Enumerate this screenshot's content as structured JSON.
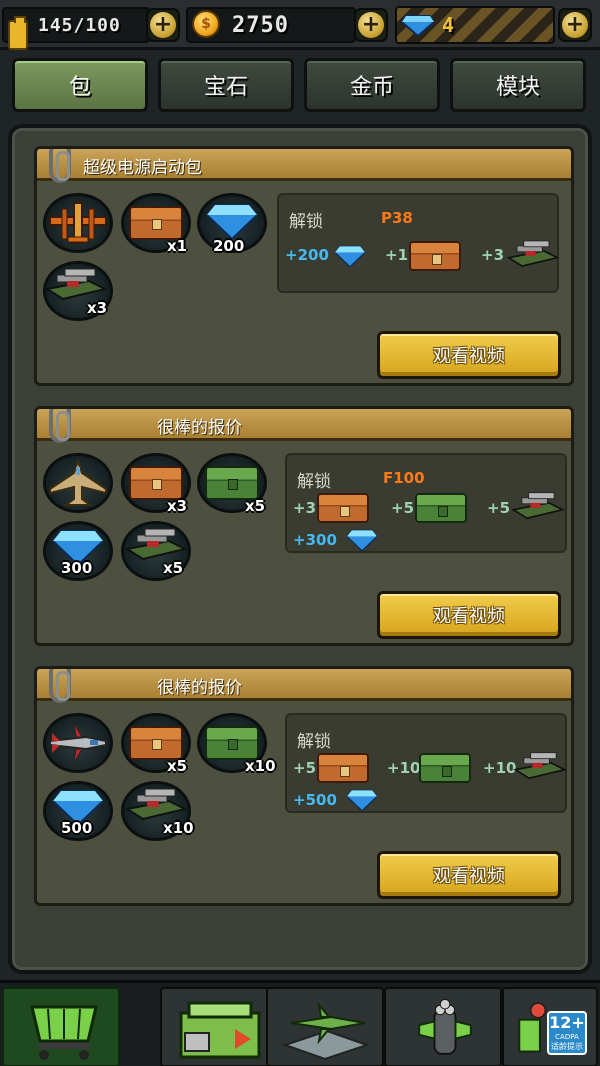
{
  "top_bar": {
    "energy": "145/100",
    "coins": "2750",
    "gems": "4"
  },
  "tabs": [
    {
      "label": "包",
      "active": true
    },
    {
      "label": "宝石",
      "active": false
    },
    {
      "label": "金币",
      "active": false
    },
    {
      "label": "模块",
      "active": false
    }
  ],
  "offers": [
    {
      "title": "超级电源启动包",
      "items": [
        {
          "icon": "plane-p38-icon",
          "qty": ""
        },
        {
          "icon": "orange-chest-icon",
          "qty": "x1"
        },
        {
          "icon": "gem-icon",
          "qty": "200"
        },
        {
          "icon": "weapon-rack-icon",
          "qty": "x3"
        }
      ],
      "unlock_label": "解锁",
      "unlock_plane": "P38",
      "rewards": [
        {
          "text": "+200",
          "icon": "gem-icon"
        },
        {
          "text": "+1",
          "icon": "orange-chest-icon"
        },
        {
          "text": "+3",
          "icon": "weapon-rack-icon"
        }
      ],
      "button": "观看视频"
    },
    {
      "title": "很棒的报价",
      "items": [
        {
          "icon": "plane-f100-icon",
          "qty": ""
        },
        {
          "icon": "orange-chest-icon",
          "qty": "x3"
        },
        {
          "icon": "green-chest-icon",
          "qty": "x5"
        },
        {
          "icon": "gem-icon",
          "qty": "300"
        },
        {
          "icon": "weapon-rack-icon",
          "qty": "x5"
        }
      ],
      "unlock_label": "解锁",
      "unlock_plane": "F100",
      "rewards": [
        {
          "text": "+3",
          "icon": "orange-chest-icon"
        },
        {
          "text": "+5",
          "icon": "green-chest-icon"
        },
        {
          "text": "+5",
          "icon": "weapon-rack-icon"
        },
        {
          "text": "+300",
          "icon": "gem-icon"
        }
      ],
      "button": "观看视频"
    },
    {
      "title": "很棒的报价",
      "items": [
        {
          "icon": "plane-red-jet-icon",
          "qty": ""
        },
        {
          "icon": "orange-chest-icon",
          "qty": "x5"
        },
        {
          "icon": "green-chest-icon",
          "qty": "x10"
        },
        {
          "icon": "gem-icon",
          "qty": "500"
        },
        {
          "icon": "weapon-rack-icon",
          "qty": "x10"
        }
      ],
      "unlock_label": "解锁",
      "unlock_plane": "",
      "rewards": [
        {
          "text": "+5",
          "icon": "orange-chest-icon"
        },
        {
          "text": "+10",
          "icon": "green-chest-icon"
        },
        {
          "text": "+10",
          "icon": "weapon-rack-icon"
        },
        {
          "text": "+500",
          "icon": "gem-icon"
        }
      ],
      "button": "观看视频"
    }
  ],
  "bottom_nav": [
    {
      "icon": "shop-cart-icon",
      "active": true
    },
    {
      "icon": "supply-crate-icon",
      "active": false
    },
    {
      "icon": "hangar-plane-icon",
      "active": false
    },
    {
      "icon": "gatling-gun-icon",
      "active": false
    },
    {
      "icon": "module-icon",
      "active": false
    }
  ],
  "age_rating": {
    "big": "12+",
    "line1": "CADPA",
    "line2": "适龄提示"
  },
  "colors": {
    "tab_active": "#6f8c54",
    "card_header": "#b88d3e",
    "button_gold": "#e0b02a",
    "plane_name": "#ff7a18",
    "gem_text": "#45b9f2"
  }
}
